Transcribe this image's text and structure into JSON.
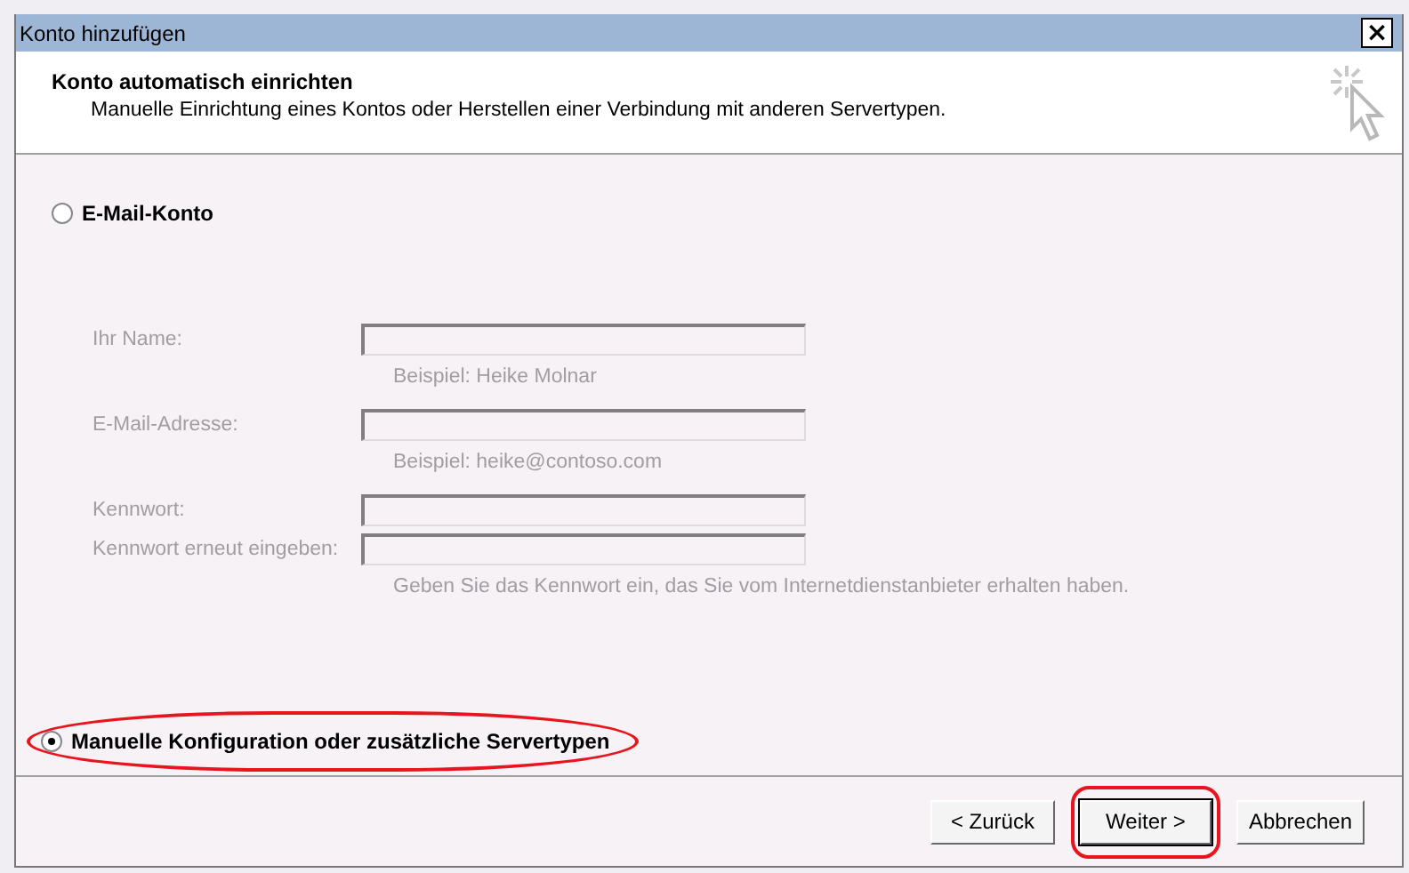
{
  "window": {
    "title": "Konto hinzufügen",
    "close_label": "×"
  },
  "header": {
    "title": "Konto automatisch einrichten",
    "subtitle": "Manuelle Einrichtung eines Kontos oder Herstellen einer Verbindung mit anderen Servertypen."
  },
  "options": [
    {
      "label": "E-Mail-Konto",
      "selected": false,
      "annotated": false
    },
    {
      "label": "Manuelle Konfiguration oder zusätzliche Servertypen",
      "selected": true,
      "annotated": true
    }
  ],
  "fields": [
    {
      "label": "Ihr Name:",
      "hint": "Beispiel: Heike Molnar",
      "disabled": true
    },
    {
      "label": "E-Mail-Adresse:",
      "hint": "Beispiel: heike@contoso.com",
      "disabled": true
    },
    {
      "label": "Kennwort:",
      "disabled": true
    },
    {
      "label": "Kennwort erneut eingeben:",
      "hint": "Geben Sie das Kennwort ein, das Sie vom Internetdienstanbieter erhalten haben.",
      "disabled": true
    }
  ],
  "buttons": [
    {
      "label": "< Zurück",
      "annotated": false,
      "default": false
    },
    {
      "label": "Weiter >",
      "annotated": true,
      "default": true
    },
    {
      "label": "Abbrechen",
      "annotated": false,
      "default": false
    }
  ]
}
